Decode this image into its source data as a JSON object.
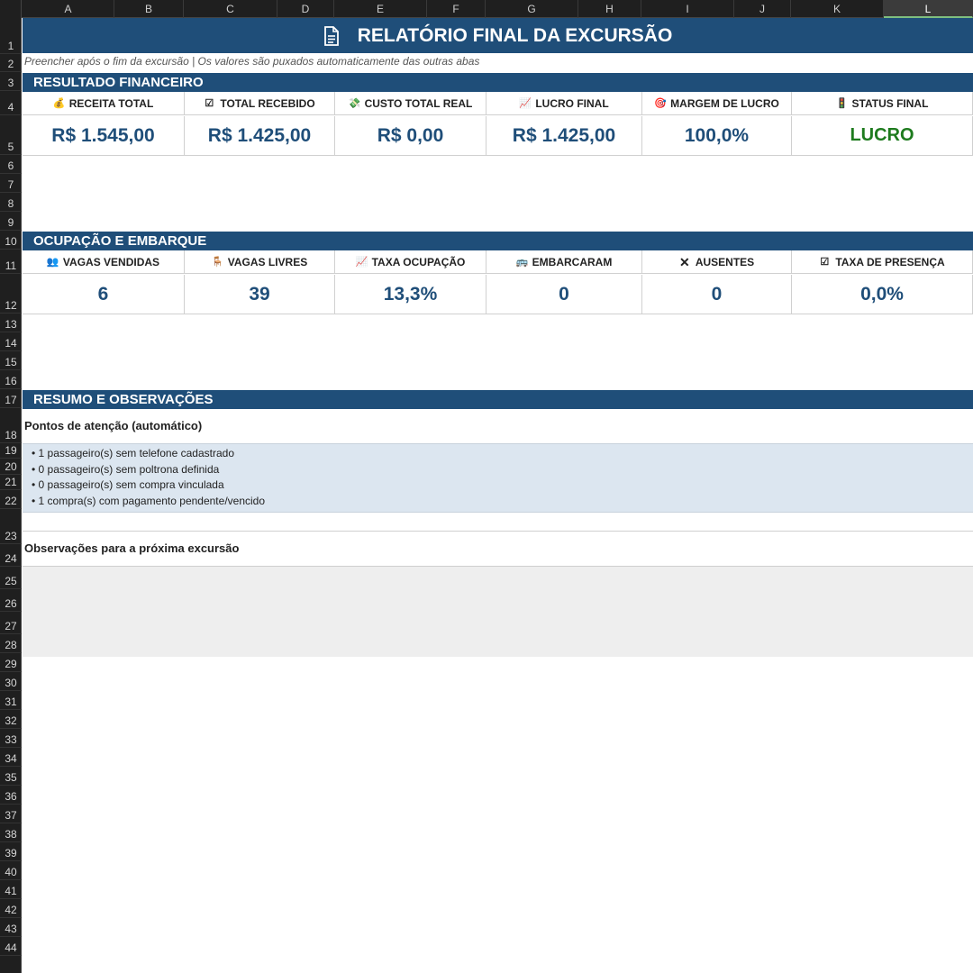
{
  "columns": [
    "A",
    "B",
    "C",
    "D",
    "E",
    "F",
    "G",
    "H",
    "I",
    "J",
    "K",
    "L"
  ],
  "selected_column": "L",
  "rows": [
    "1",
    "2",
    "3",
    "4",
    "5",
    "6",
    "7",
    "8",
    "9",
    "10",
    "11",
    "12",
    "13",
    "14",
    "15",
    "16",
    "17",
    "18",
    "19",
    "20",
    "21",
    "22",
    "23",
    "24",
    "25",
    "26",
    "27",
    "28",
    "29",
    "30",
    "31",
    "32",
    "33",
    "34",
    "35",
    "36",
    "37",
    "38",
    "39",
    "40",
    "41",
    "42",
    "43",
    "44"
  ],
  "title": "RELATÓRIO FINAL DA EXCURSÃO",
  "subtitle": "Preencher após o fim da excursão   |   Os valores são puxados automaticamente das outras abas",
  "financeiro": {
    "section_title": "RESULTADO FINANCEIRO",
    "items": [
      {
        "label": "RECEITA TOTAL",
        "value": "R$ 1.545,00",
        "icon": "money-bag-icon"
      },
      {
        "label": "TOTAL RECEBIDO",
        "value": "R$ 1.425,00",
        "icon": "check-box-icon"
      },
      {
        "label": "CUSTO TOTAL REAL",
        "value": "R$ 0,00",
        "icon": "money-wings-icon"
      },
      {
        "label": "LUCRO FINAL",
        "value": "R$ 1.425,00",
        "icon": "chart-up-icon"
      },
      {
        "label": "MARGEM DE LUCRO",
        "value": "100,0%",
        "icon": "target-icon"
      },
      {
        "label": "STATUS FINAL",
        "value": "LUCRO",
        "icon": "traffic-light-icon"
      }
    ]
  },
  "ocupacao": {
    "section_title": "OCUPAÇÃO E EMBARQUE",
    "items": [
      {
        "label": "VAGAS VENDIDAS",
        "value": "6",
        "icon": "people-icon"
      },
      {
        "label": "VAGAS LIVRES",
        "value": "39",
        "icon": "seat-icon"
      },
      {
        "label": "TAXA OCUPAÇÃO",
        "value": "13,3%",
        "icon": "chart-up-icon"
      },
      {
        "label": "EMBARCARAM",
        "value": "0",
        "icon": "bus-icon"
      },
      {
        "label": "AUSENTES",
        "value": "0",
        "icon": "cross-mark-icon"
      },
      {
        "label": "TAXA DE PRESENÇA",
        "value": "0,0%",
        "icon": "check-box-icon"
      }
    ]
  },
  "resumo": {
    "section_title": "RESUMO E OBSERVAÇÕES",
    "attention_heading": "Pontos de atenção (automático)",
    "attention_items": [
      "• 1 passageiro(s) sem telefone cadastrado",
      "• 0 passageiro(s) sem poltrona definida",
      "• 0 passageiro(s) sem compra vinculada",
      "• 1 compra(s) com pagamento pendente/vencido"
    ],
    "observations_heading": "Observações para a próxima excursão"
  },
  "colors": {
    "header_blue": "#1f4e79",
    "value_blue": "#1f4e79",
    "status_green": "#1e7b1e",
    "attention_bg": "#dce6f0"
  }
}
